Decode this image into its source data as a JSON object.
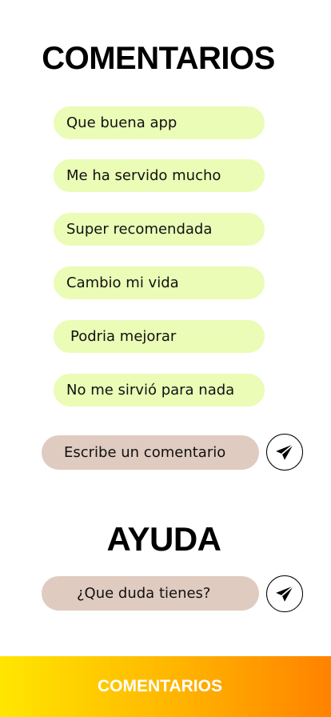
{
  "header": {
    "title": "COMENTARIOS"
  },
  "comments": [
    {
      "text": "Que buena app"
    },
    {
      "text": "Me ha servido mucho"
    },
    {
      "text": "Super recomendada"
    },
    {
      "text": "Cambio mi vida"
    },
    {
      "text": "Podria mejorar"
    },
    {
      "text": "No me sirvió para nada"
    }
  ],
  "comment_input": {
    "placeholder": "Escribe un comentario",
    "send_icon": "send-icon"
  },
  "help": {
    "title": "AYUDA",
    "placeholder": "¿Que duda tienes?",
    "send_icon": "send-icon"
  },
  "bottom_bar": {
    "label": "COMENTARIOS"
  },
  "colors": {
    "comment_bubble": "#eafcb6",
    "input_pill": "#e0cbc1",
    "gradient_start": "#ffe600",
    "gradient_end": "#ff8200"
  }
}
